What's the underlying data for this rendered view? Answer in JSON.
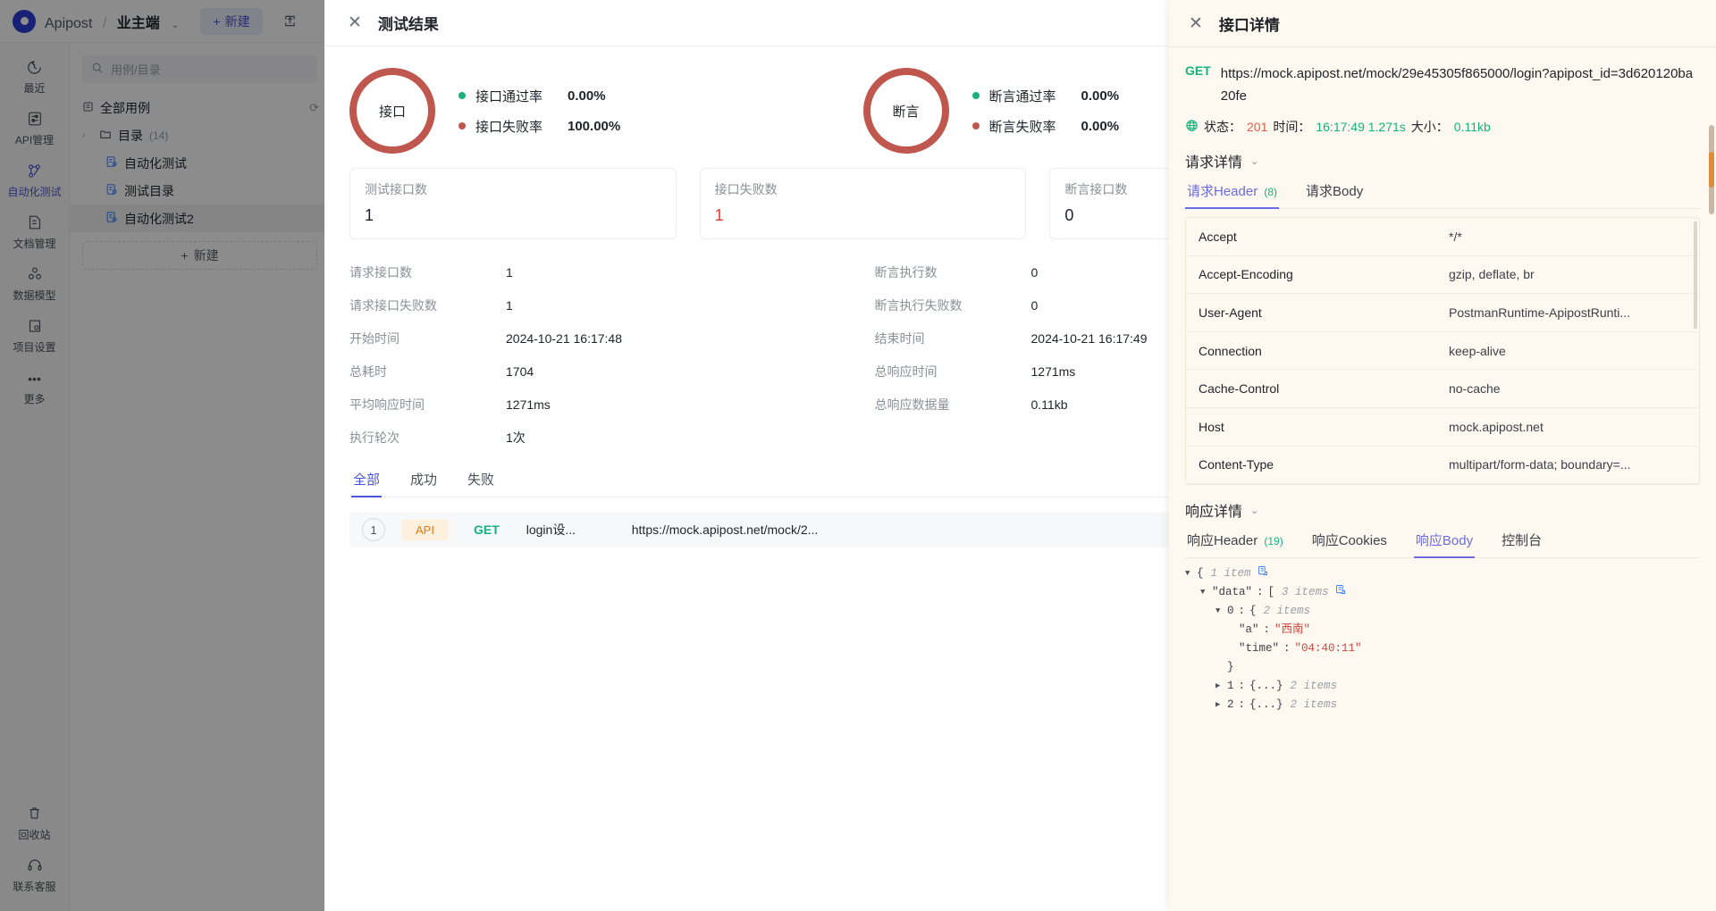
{
  "topbar": {
    "brand": "Apipost",
    "separator": "/",
    "project": "业主端",
    "caret": "⌄",
    "new_button": "新建",
    "new_icon": "+",
    "import_icon": "⇪"
  },
  "rail": {
    "items": [
      {
        "label": "最近",
        "icon": "◷",
        "name": "recent"
      },
      {
        "label": "API管理",
        "icon": "▤",
        "name": "api-manage"
      },
      {
        "label": "自动化测试",
        "icon": "⚯",
        "name": "auto-test",
        "active": true
      },
      {
        "label": "文档管理",
        "icon": "▤",
        "name": "doc-manage"
      },
      {
        "label": "数据模型",
        "icon": "⛁",
        "name": "data-model"
      },
      {
        "label": "项目设置",
        "icon": "⬓",
        "name": "project-settings"
      },
      {
        "label": "更多",
        "icon": "•••",
        "name": "more"
      }
    ],
    "bottom_items": [
      {
        "label": "回收站",
        "icon": "🗑",
        "name": "recycle-bin"
      },
      {
        "label": "联系客服",
        "icon": "🎧",
        "name": "contact-support"
      }
    ]
  },
  "tree": {
    "search_placeholder": "用例/目录",
    "search_icon": "🔍",
    "root": {
      "label": "全部用例",
      "icon": "▤",
      "refresh_icon": "⟳"
    },
    "nodes": [
      {
        "label": "目录",
        "count": "(14)",
        "icon": "📁",
        "chevron": "›",
        "type": "folder"
      },
      {
        "label": "自动化测试",
        "icon": "▤",
        "type": "case"
      },
      {
        "label": "测试目录",
        "icon": "▤",
        "type": "case"
      },
      {
        "label": "自动化测试2",
        "icon": "▤",
        "type": "case",
        "selected": true
      }
    ],
    "add_label": "新建",
    "add_icon": "+"
  },
  "results": {
    "close_icon": "✕",
    "title": "测试结果",
    "donuts": [
      {
        "center_label": "接口",
        "legend": [
          {
            "label": "接口通过率",
            "value": "0.00%",
            "color": "#18b37d"
          },
          {
            "label": "接口失败率",
            "value": "100.00%",
            "color": "#c0574e"
          }
        ]
      },
      {
        "center_label": "断言",
        "legend": [
          {
            "label": "断言通过率",
            "value": "0.00%",
            "color": "#18b37d"
          },
          {
            "label": "断言失败率",
            "value": "0.00%",
            "color": "#c0574e"
          }
        ]
      }
    ],
    "kpis": [
      {
        "title": "测试接口数",
        "value": "1",
        "red": false
      },
      {
        "title": "接口失败数",
        "value": "1",
        "red": true
      },
      {
        "title": "断言接口数",
        "value": "0",
        "red": false
      }
    ],
    "stats_left": [
      {
        "key": "请求接口数",
        "value": "1"
      },
      {
        "key": "请求接口失败数",
        "value": "1"
      },
      {
        "key": "开始时间",
        "value": "2024-10-21 16:17:48"
      },
      {
        "key": "总耗时",
        "value": "1704"
      },
      {
        "key": "平均响应时间",
        "value": "1271ms"
      },
      {
        "key": "执行轮次",
        "value": "1次"
      }
    ],
    "stats_right": [
      {
        "key": "断言执行数",
        "value": "0"
      },
      {
        "key": "断言执行失败数",
        "value": "0"
      },
      {
        "key": "结束时间",
        "value": "2024-10-21 16:17:49"
      },
      {
        "key": "总响应时间",
        "value": "1271ms"
      },
      {
        "key": "总响应数据量",
        "value": "0.11kb"
      }
    ],
    "tabs": [
      {
        "label": "全部",
        "active": true
      },
      {
        "label": "成功",
        "active": false
      },
      {
        "label": "失败",
        "active": false
      }
    ],
    "row": {
      "index": "1",
      "tag": "API",
      "method": "GET",
      "name": "login设...",
      "url": "https://mock.apipost.net/mock/2..."
    }
  },
  "detail": {
    "close_icon": "✕",
    "title": "接口详情",
    "method": "GET",
    "url": "https://mock.apipost.net/mock/29e45305f865000/login?apipost_id=3d620120ba20fe",
    "globe_icon": "🌐",
    "status_key": "状态：",
    "status_value": "201",
    "time_key": "时间：",
    "time_value": "16:17:49 1.271s",
    "size_key": "大小：",
    "size_value": "0.11kb",
    "request_section": "请求详情",
    "chevron": "⌄",
    "request_tabs": [
      {
        "label": "请求Header",
        "count": "(8)",
        "active": true
      },
      {
        "label": "请求Body",
        "count": "",
        "active": false
      }
    ],
    "headers": [
      {
        "key": "Accept",
        "value": "*/*"
      },
      {
        "key": "Accept-Encoding",
        "value": "gzip, deflate, br"
      },
      {
        "key": "User-Agent",
        "value": "PostmanRuntime-ApipostRunti..."
      },
      {
        "key": "Connection",
        "value": "keep-alive"
      },
      {
        "key": "Cache-Control",
        "value": "no-cache"
      },
      {
        "key": "Host",
        "value": "mock.apipost.net"
      },
      {
        "key": "Content-Type",
        "value": "multipart/form-data; boundary=..."
      }
    ],
    "response_section": "响应详情",
    "response_tabs": [
      {
        "label": "响应Header",
        "count": "(19)",
        "active": false
      },
      {
        "label": "响应Cookies",
        "count": "",
        "active": false
      },
      {
        "label": "响应Body",
        "count": "",
        "active": true
      },
      {
        "label": "控制台",
        "count": "",
        "active": false
      }
    ],
    "json_lines": [
      {
        "indent": 0,
        "arrow": "▼",
        "text": "{",
        "items": "1 item",
        "copy": true
      },
      {
        "indent": 1,
        "arrow": "▼",
        "key": "\"data\"",
        "colon": ":",
        "text": "[",
        "items": "3 items",
        "copy": true
      },
      {
        "indent": 2,
        "arrow": "▼",
        "key": "0",
        "colon": ":",
        "text": "{",
        "items": "2 items",
        "copy": false
      },
      {
        "indent": 3,
        "arrow": "",
        "key": "\"a\"",
        "colon": ":",
        "str": "\"西南\""
      },
      {
        "indent": 3,
        "arrow": "",
        "key": "\"time\"",
        "colon": ":",
        "str": "\"04:40:11\""
      },
      {
        "indent": 2,
        "arrow": "",
        "text": "}"
      },
      {
        "indent": 2,
        "arrow": "▶",
        "key": "1",
        "colon": ":",
        "text": "{...}",
        "items": "2 items"
      },
      {
        "indent": 2,
        "arrow": "▶",
        "key": "2",
        "colon": ":",
        "text": "{...}",
        "items": "2 items"
      }
    ]
  }
}
